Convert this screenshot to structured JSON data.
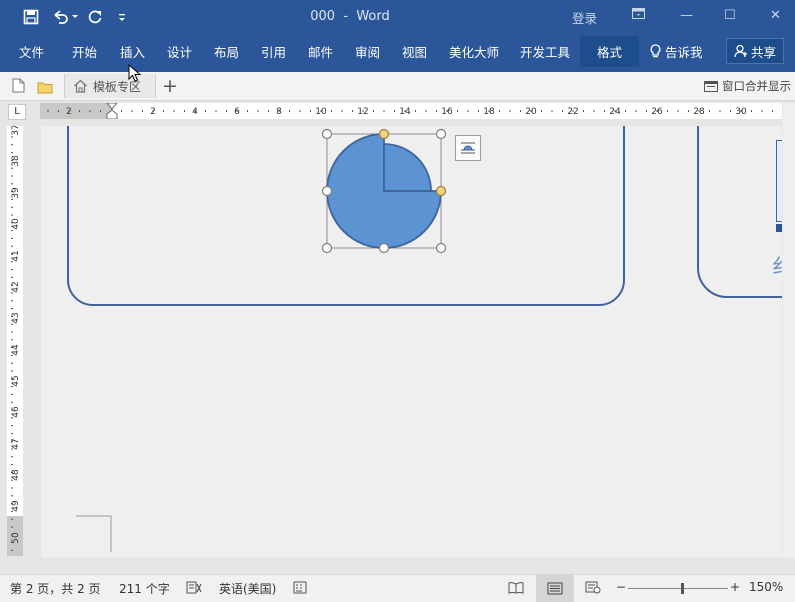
{
  "window": {
    "document_name": "000",
    "separator": "-",
    "app_name": "Word",
    "signin_label": "登录",
    "minimize_glyph": "—",
    "restore_glyph": "☐",
    "close_glyph": "✕"
  },
  "ribbon": {
    "tabs": [
      {
        "label": "文件"
      },
      {
        "label": "开始"
      },
      {
        "label": "插入"
      },
      {
        "label": "设计"
      },
      {
        "label": "布局"
      },
      {
        "label": "引用"
      },
      {
        "label": "邮件"
      },
      {
        "label": "审阅"
      },
      {
        "label": "视图"
      },
      {
        "label": "美化大师"
      },
      {
        "label": "开发工具"
      },
      {
        "label": "格式"
      }
    ],
    "active_tab": "格式",
    "tell_me": "告诉我",
    "share": "共享"
  },
  "doc_tabs": {
    "tab_label": "模板专区",
    "new_tab_glyph": "+",
    "merge_windows": "窗口合并显示"
  },
  "ruler": {
    "corner_glyph": "L",
    "h_labels": [
      "2",
      "2",
      "4",
      "6",
      "8",
      "10",
      "12",
      "14",
      "16",
      "18",
      "20",
      "22",
      "24",
      "26",
      "28",
      "30"
    ],
    "v_labels": [
      "37",
      "38",
      "39",
      "40",
      "41",
      "42",
      "43",
      "44",
      "45",
      "46",
      "47",
      "48",
      "49",
      "50"
    ]
  },
  "canvas": {
    "right_frame_char": "纟"
  },
  "status": {
    "page_info": "第 2 页，共 2 页",
    "word_count": "211 个字",
    "language": "英语(美国)",
    "zoom_minus": "−",
    "zoom_plus": "+",
    "zoom_level": "150%",
    "zoom_fraction": 0.5
  },
  "colors": {
    "ribbon_blue": "#2b579a",
    "pie_fill": "#5b93d3",
    "shape_stroke": "#41639b"
  }
}
